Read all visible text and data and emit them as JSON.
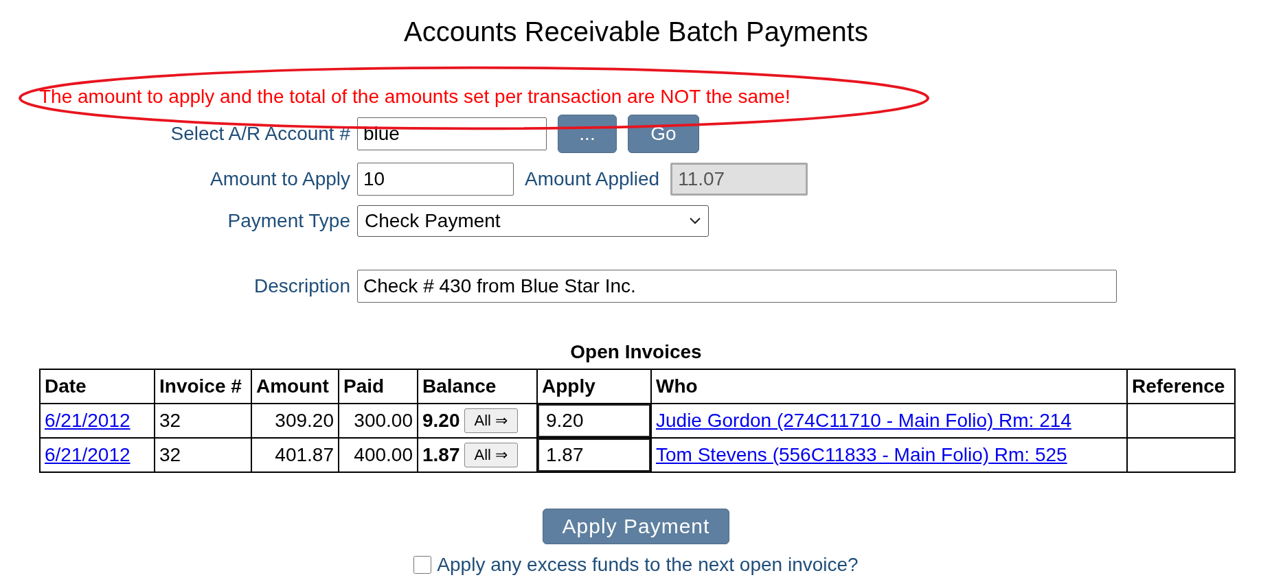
{
  "title": "Accounts Receivable Batch Payments",
  "error_message": "The amount to apply and the total of the amounts set per transaction are NOT the same!",
  "form": {
    "account": {
      "label": "Select A/R Account #",
      "value": "blue",
      "browse_button": "...",
      "go_button": "Go"
    },
    "amount_to_apply": {
      "label": "Amount to Apply",
      "value": "10"
    },
    "amount_applied": {
      "label": "Amount Applied",
      "value": "11.07",
      "disabled": true
    },
    "payment_type": {
      "label": "Payment Type",
      "value": "Check Payment"
    },
    "description": {
      "label": "Description",
      "value": "Check # 430 from Blue Star Inc."
    }
  },
  "invoices": {
    "title": "Open Invoices",
    "columns": [
      "Date",
      "Invoice #",
      "Amount",
      "Paid",
      "Balance",
      "Apply",
      "Who",
      "Reference"
    ],
    "rows": [
      {
        "date": "6/21/2012",
        "invoice": "32",
        "amount": "309.20",
        "paid": "300.00",
        "balance": "9.20",
        "all_button": "All ⇒",
        "apply": "9.20",
        "who": "Judie Gordon (274C11710 - Main Folio) Rm: 214"
      },
      {
        "date": "6/21/2012",
        "invoice": "32",
        "amount": "401.87",
        "paid": "400.00",
        "balance": "1.87",
        "all_button": "All ⇒",
        "apply": "1.87",
        "who": "Tom Stevens (556C11833 - Main Folio) Rm: 525"
      }
    ]
  },
  "apply_button": "Apply Payment",
  "excess_checkbox": {
    "label": "Apply any excess funds to the next open invoice?",
    "checked": false
  }
}
